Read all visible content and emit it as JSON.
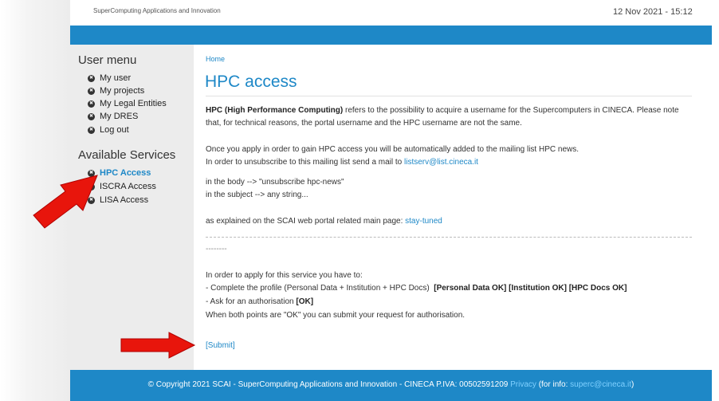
{
  "header": {
    "site_name": "SuperComputing Applications and Innovation",
    "datetime": "12 Nov 2021 - 15:12"
  },
  "sidebar": {
    "user_menu_title": "User menu",
    "user_items": [
      {
        "label": "My user"
      },
      {
        "label": "My projects"
      },
      {
        "label": "My Legal Entities"
      },
      {
        "label": "My DRES"
      },
      {
        "label": "Log out"
      }
    ],
    "services_title": "Available Services",
    "service_items": [
      {
        "label": "HPC Access"
      },
      {
        "label": "ISCRA Access"
      },
      {
        "label": "LISA Access"
      }
    ]
  },
  "main": {
    "breadcrumb": "Home",
    "title": "HPC access",
    "intro_bold": "HPC (High Performance Computing)",
    "intro_rest": " refers to the possibility to acquire a username for the Supercomputers in CINECA. Please note that, for technical reasons, the portal username and the HPC username are not the same.",
    "mailing_line1": "Once you apply in order to gain HPC access you will be automatically added to the mailing list HPC news.",
    "mailing_line2": "In order to unsubscribe to this mailing list send a mail to ",
    "mailing_email": "listserv@list.cineca.it",
    "body_line": "in the body --> \"unsubscribe hpc-news\"",
    "subject_line": "in the subject --> any string...",
    "explained_text": "as explained on the SCAI web portal related main page: ",
    "stay_tuned": "stay-tuned",
    "dashes": "--------",
    "apply_intro": "In order to apply for this service you have to:",
    "apply_step1": "- Complete the profile (Personal Data + Institution + HPC Docs)",
    "apply_step1_status": "[Personal Data OK] [Institution OK] [HPC Docs OK]",
    "apply_step2": "- Ask for an authorisation",
    "apply_step2_status": "[OK]",
    "apply_final": "When both points are \"OK\" you can submit your request for authorisation.",
    "submit_label": "[Submit]"
  },
  "footer": {
    "copyright": "© Copyright 2021 SCAI - SuperComputing Applications and Innovation - CINECA P.IVA: 00502591209",
    "privacy": "Privacy",
    "info_prefix": "(for info:",
    "info_email": "superc@cineca.it",
    "info_suffix": ")"
  },
  "colors": {
    "brand_blue": "#1e88c7",
    "annotation_red": "#e8150c"
  }
}
